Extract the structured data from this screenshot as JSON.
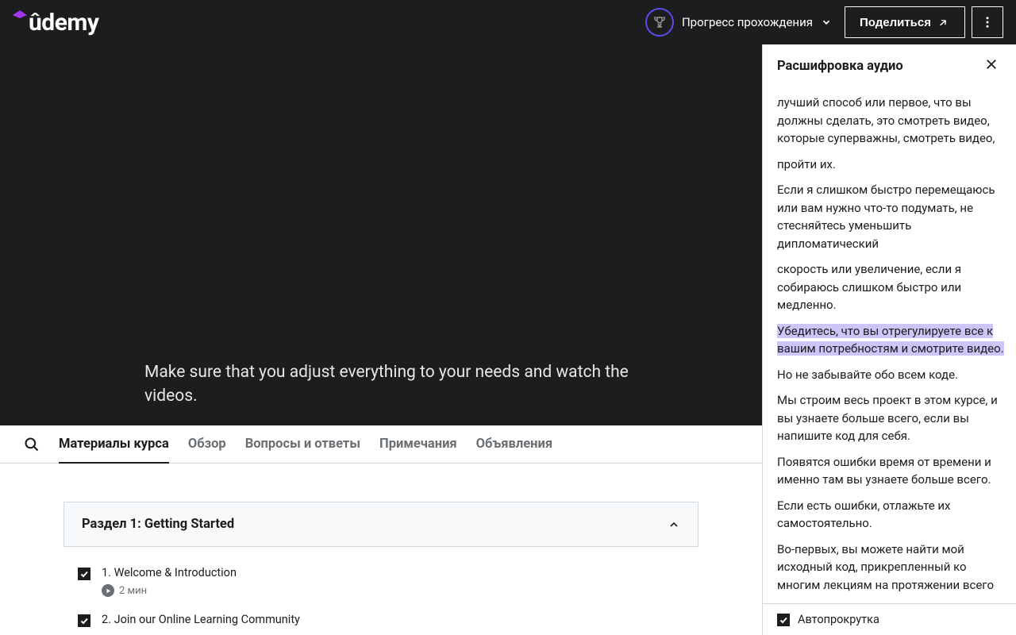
{
  "header": {
    "logo_text": "ûdemy",
    "progress_label": "Прогресс прохождения",
    "share_label": "Поделиться"
  },
  "video": {
    "subtitle": "Make sure that you adjust everything to your needs and watch the videos."
  },
  "tabs": [
    {
      "label": "Материалы курса",
      "active": true
    },
    {
      "label": "Обзор",
      "active": false
    },
    {
      "label": "Вопросы и ответы",
      "active": false
    },
    {
      "label": "Примечания",
      "active": false
    },
    {
      "label": "Объявления",
      "active": false
    }
  ],
  "section": {
    "title": "Раздел 1: Getting Started",
    "lectures": [
      {
        "title": "1. Welcome & Introduction",
        "duration": "2 мин",
        "completed": true
      },
      {
        "title": "2. Join our Online Learning Community",
        "completed": true
      }
    ]
  },
  "transcript": {
    "title": "Расшифровка аудио",
    "lines": [
      {
        "text": "лучший способ или первое, что вы должны сделать, это смотреть видео, которые суперважны, смотреть видео,",
        "highlight": false
      },
      {
        "text": "пройти их.",
        "highlight": false
      },
      {
        "text": "Если я слишком быстро перемещаюсь или вам нужно что-то подумать, не стесняйтесь уменьшить дипломатический",
        "highlight": false
      },
      {
        "text": "скорость или увеличение, если я собираюсь слишком быстро или медленно.",
        "highlight": false
      },
      {
        "text": "Убедитесь, что вы отрегулируете все к вашим потребностям и смотрите видео.",
        "highlight": true
      },
      {
        "text": "Но не забывайте обо всем коде.",
        "highlight": false
      },
      {
        "text": "Мы строим весь проект в этом курсе, и вы узнаете больше всего, если вы напишите код для себя.",
        "highlight": false
      },
      {
        "text": "Появятся ошибки время от времени и именно там вы узнаете больше всего.",
        "highlight": false
      },
      {
        "text": "Если есть ошибки, отлажьте их самостоятельно.",
        "highlight": false
      },
      {
        "text": "Во-первых, вы можете найти мой исходный код, прикрепленный ко многим лекциям на протяжении всего",
        "highlight": false
      }
    ],
    "autoscroll_label": "Автопрокрутка",
    "autoscroll_checked": true
  }
}
